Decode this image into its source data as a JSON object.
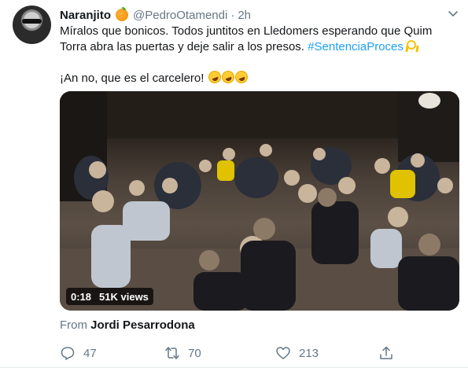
{
  "tweet": {
    "author_name": "Naranjito",
    "author_emoji": "orange-emoji",
    "handle": "@PedroOtamendi",
    "separator": "·",
    "time": "2h",
    "line1": "Míralos que bonicos. Todos juntitos  en Lledomers esperando que Quim",
    "line2_text": "Torra abra las puertas y deje salir a los presos. ",
    "hashtag": "#SentenciaProces",
    "line3_text": "¡An no, que es el carcelero! ",
    "media": {
      "duration": "0:18",
      "views": "51K views"
    },
    "from_label": "From ",
    "from_name": "Jordi Pesarrodona",
    "actions": {
      "replies": "47",
      "retweets": "70",
      "likes": "213"
    }
  }
}
